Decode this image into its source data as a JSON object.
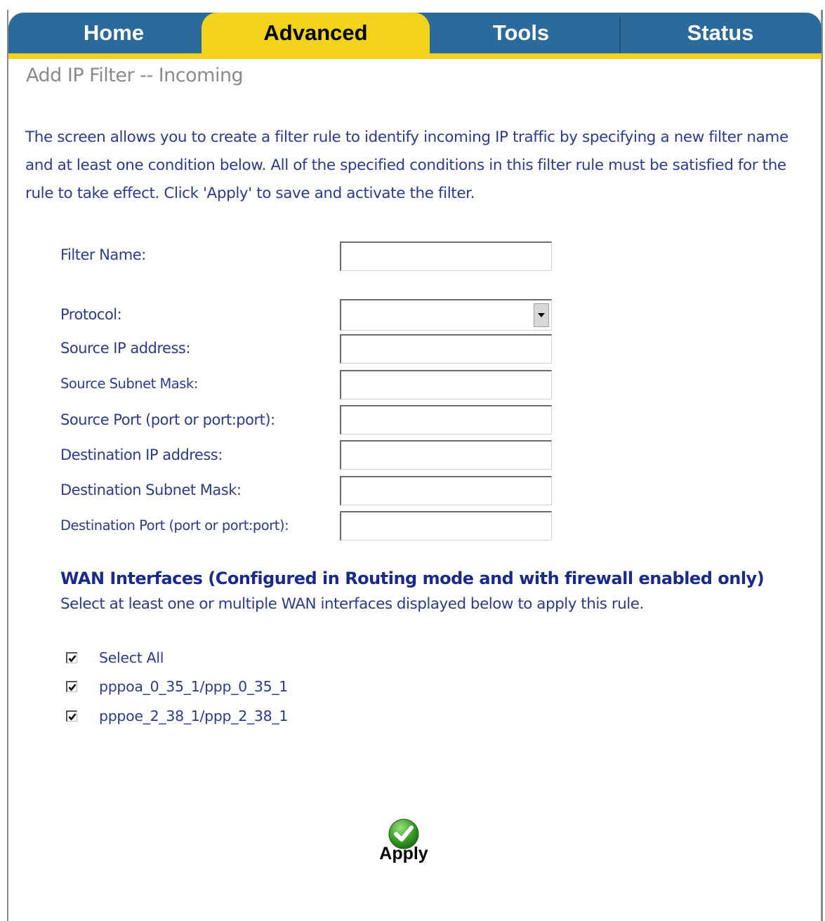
{
  "nav": {
    "tabs": [
      {
        "label": "Home"
      },
      {
        "label": "Advanced",
        "active": true
      },
      {
        "label": "Tools"
      },
      {
        "label": "Status"
      }
    ]
  },
  "page": {
    "title": "Add IP Filter -- Incoming",
    "description": "The screen allows you to create a filter rule to identify incoming IP traffic by specifying a new filter name and at least one condition below. All of the specified conditions in this filter rule must be satisfied for the rule to take effect. Click 'Apply' to save and activate the filter."
  },
  "form": {
    "filter_name": {
      "label": "Filter Name:",
      "value": ""
    },
    "protocol": {
      "label": "Protocol:",
      "value": ""
    },
    "source_ip": {
      "label": "Source IP address:",
      "value": ""
    },
    "source_mask": {
      "label": "Source Subnet Mask:",
      "value": ""
    },
    "source_port": {
      "label": "Source Port (port or port:port):",
      "value": ""
    },
    "dest_ip": {
      "label": "Destination IP address:",
      "value": ""
    },
    "dest_mask": {
      "label": "Destination Subnet Mask:",
      "value": ""
    },
    "dest_port": {
      "label": "Destination Port (port or port:port):",
      "value": ""
    }
  },
  "wan": {
    "heading": "WAN Interfaces (Configured in Routing mode and with firewall enabled only)",
    "subtext": "Select at least one or multiple WAN interfaces displayed below to apply this rule.",
    "options": [
      {
        "label": "Select All",
        "checked": true
      },
      {
        "label": "pppoa_0_35_1/ppp_0_35_1",
        "checked": true
      },
      {
        "label": "pppoe_2_38_1/ppp_2_38_1",
        "checked": true
      }
    ]
  },
  "apply": {
    "label": "Apply",
    "icon": "checkmark-icon",
    "color": "#3aa12a"
  },
  "colors": {
    "nav_bg": "#2b6a9b",
    "active_tab": "#f2d21a",
    "text": "#2b3b8c",
    "heading": "#1a2a8a"
  }
}
